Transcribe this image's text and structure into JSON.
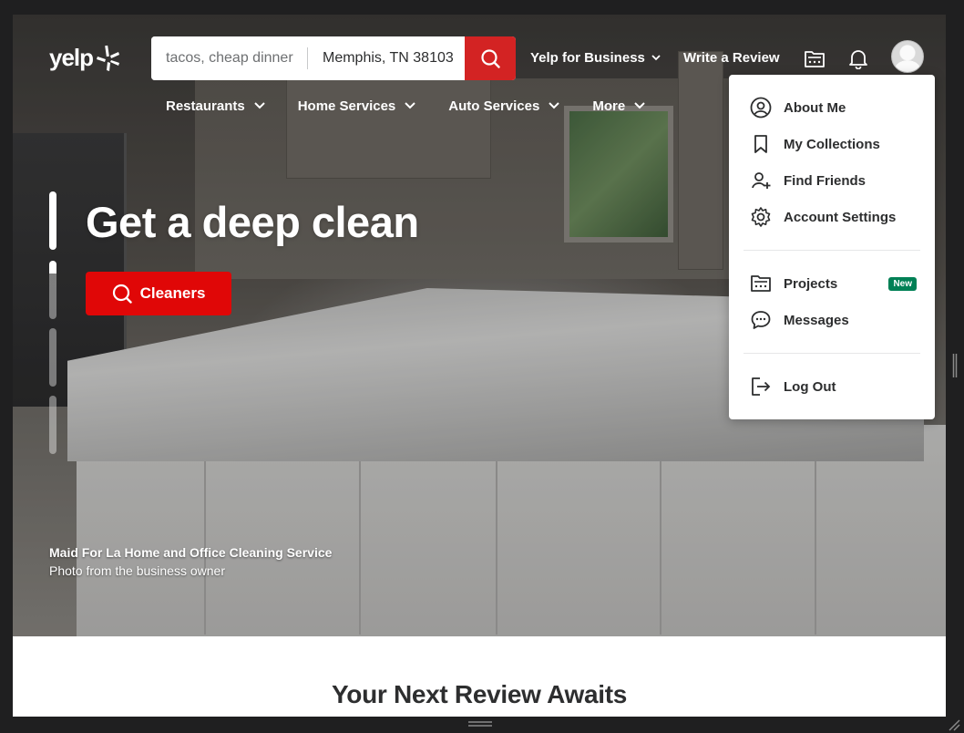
{
  "header": {
    "logo_text": "yelp",
    "search_find_value": "tacos, cheap dinner",
    "search_near_value": "Memphis, TN 38103",
    "yelp_for_business": "Yelp for Business",
    "write_review": "Write a Review"
  },
  "categories": [
    {
      "label": "Restaurants"
    },
    {
      "label": "Home Services"
    },
    {
      "label": "Auto Services"
    },
    {
      "label": "More"
    }
  ],
  "hero": {
    "title": "Get a deep clean",
    "button_label": "Cleaners",
    "business_name": "Maid For La Home and Office Cleaning Service",
    "photo_credit": "Photo from the business owner"
  },
  "section_title": "Your Next Review Awaits",
  "user_menu": {
    "items": [
      {
        "label": "About Me",
        "icon": "user-circle-icon"
      },
      {
        "label": "My Collections",
        "icon": "bookmark-icon"
      },
      {
        "label": "Find Friends",
        "icon": "add-friend-icon"
      },
      {
        "label": "Account Settings",
        "icon": "gear-icon"
      },
      {
        "label": "Projects",
        "icon": "projects-icon",
        "badge": "New"
      },
      {
        "label": "Messages",
        "icon": "chat-icon"
      },
      {
        "label": "Log Out",
        "icon": "logout-icon"
      }
    ]
  },
  "colors": {
    "brand_red": "#d32323",
    "button_red": "#e00707",
    "badge_green": "#008055"
  }
}
